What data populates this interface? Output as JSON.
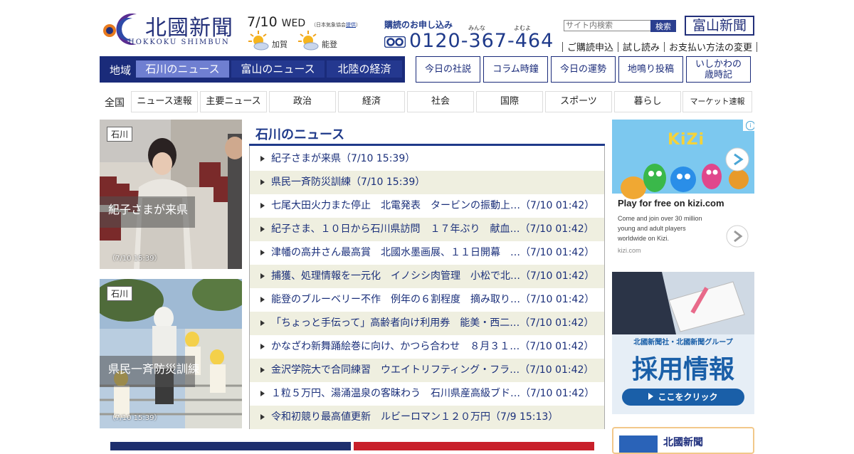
{
  "header": {
    "logo_title": "北國新聞",
    "logo_sub": "HOKKOKU SHIMBUN",
    "date": "7/10",
    "weekday": "WED",
    "jma_note_prefix": "（日本気象協会",
    "jma_note_link": "提供",
    "jma_note_suffix": "）",
    "weather": [
      {
        "area": "加賀",
        "icon": "sun-cloud-icon"
      },
      {
        "area": "能登",
        "icon": "sun-cloud-icon"
      }
    ],
    "subscribe_title": "購読のお申し込み",
    "ruby_left": "みんな",
    "ruby_right": "よむよ",
    "phone": "0120-367-464",
    "search_placeholder": "サイト内検索",
    "search_button": "検索",
    "toyama_link": "富山新聞",
    "links": [
      "ご購読申込",
      "試し読み",
      "お支払い方法の変更"
    ]
  },
  "region_nav": {
    "label": "地域",
    "tabs": [
      "石川のニュース",
      "富山のニュース",
      "北陸の経済"
    ],
    "active": "石川のニュース"
  },
  "quick_buttons": [
    "今日の社説",
    "コラム時鐘",
    "今日の運勢",
    "地鳴り投稿",
    "いしかわの",
    "歳時記"
  ],
  "categories": {
    "label": "全国",
    "items": [
      "ニュース速報",
      "主要ニュース",
      "政治",
      "経済",
      "社会",
      "国際",
      "スポーツ",
      "暮らし",
      "マーケット速報"
    ]
  },
  "cards": [
    {
      "tag": "石川",
      "caption": "紀子さまが来県",
      "time": "（7/10 15:39）"
    },
    {
      "tag": "石川",
      "caption": "県民一斉防災訓練",
      "time": "（7/10 15:39）"
    }
  ],
  "news": {
    "heading": "石川のニュース",
    "items": [
      "紀子さまが来県（7/10 15:39）",
      "県民一斉防災訓練（7/10 15:39）",
      "七尾大田火力また停止　北電発表　タービンの振動上…（7/10 01:42）",
      "紀子さま、１０日から石川県訪問　１７年ぶり　献血…（7/10 01:42）",
      "津幡の高井さん最高賞　北國水墨画展、１１日開幕　…（7/10 01:42）",
      "捕獲、処理情報を一元化　イノシシ肉管理　小松で北…（7/10 01:42）",
      "能登のブルーベリー不作　例年の６割程度　摘み取り…（7/10 01:42）",
      "「ちょっと手伝って」高齢者向け利用券　能美・西二…（7/10 01:42）",
      "かなざわ新舞踊絵巻に向け、かつら合わせ　８月３１…（7/10 01:42）",
      "金沢学院大で合同練習　ウエイトリフティング・フラ…（7/10 01:42）",
      "１粒５万円、湯涌温泉の客昧わう　石川県産高級ブド…（7/10 01:42）",
      "令和初競り最高値更新　ルビーロマン１２０万円（7/9 15:13）"
    ]
  },
  "ads": {
    "kizi_logo": "KiZi",
    "kizi_title": "Play for free on kizi.com",
    "kizi_text_1": "Come and join over 30 million",
    "kizi_text_2": "young and adult players",
    "kizi_text_3": "worldwide on Kizi.",
    "kizi_domain": "kizi.com",
    "recruit_sub": "北國新聞社・北國新聞グループ",
    "recruit_title": "採用情報",
    "recruit_btn": "ここをクリック",
    "partner_label": "北國新聞"
  },
  "colors": {
    "brand_navy": "#1a2b7a",
    "link_blue": "#1f3a8a",
    "alt_row": "#efefe0",
    "active_tab": "#6f7fd1"
  }
}
